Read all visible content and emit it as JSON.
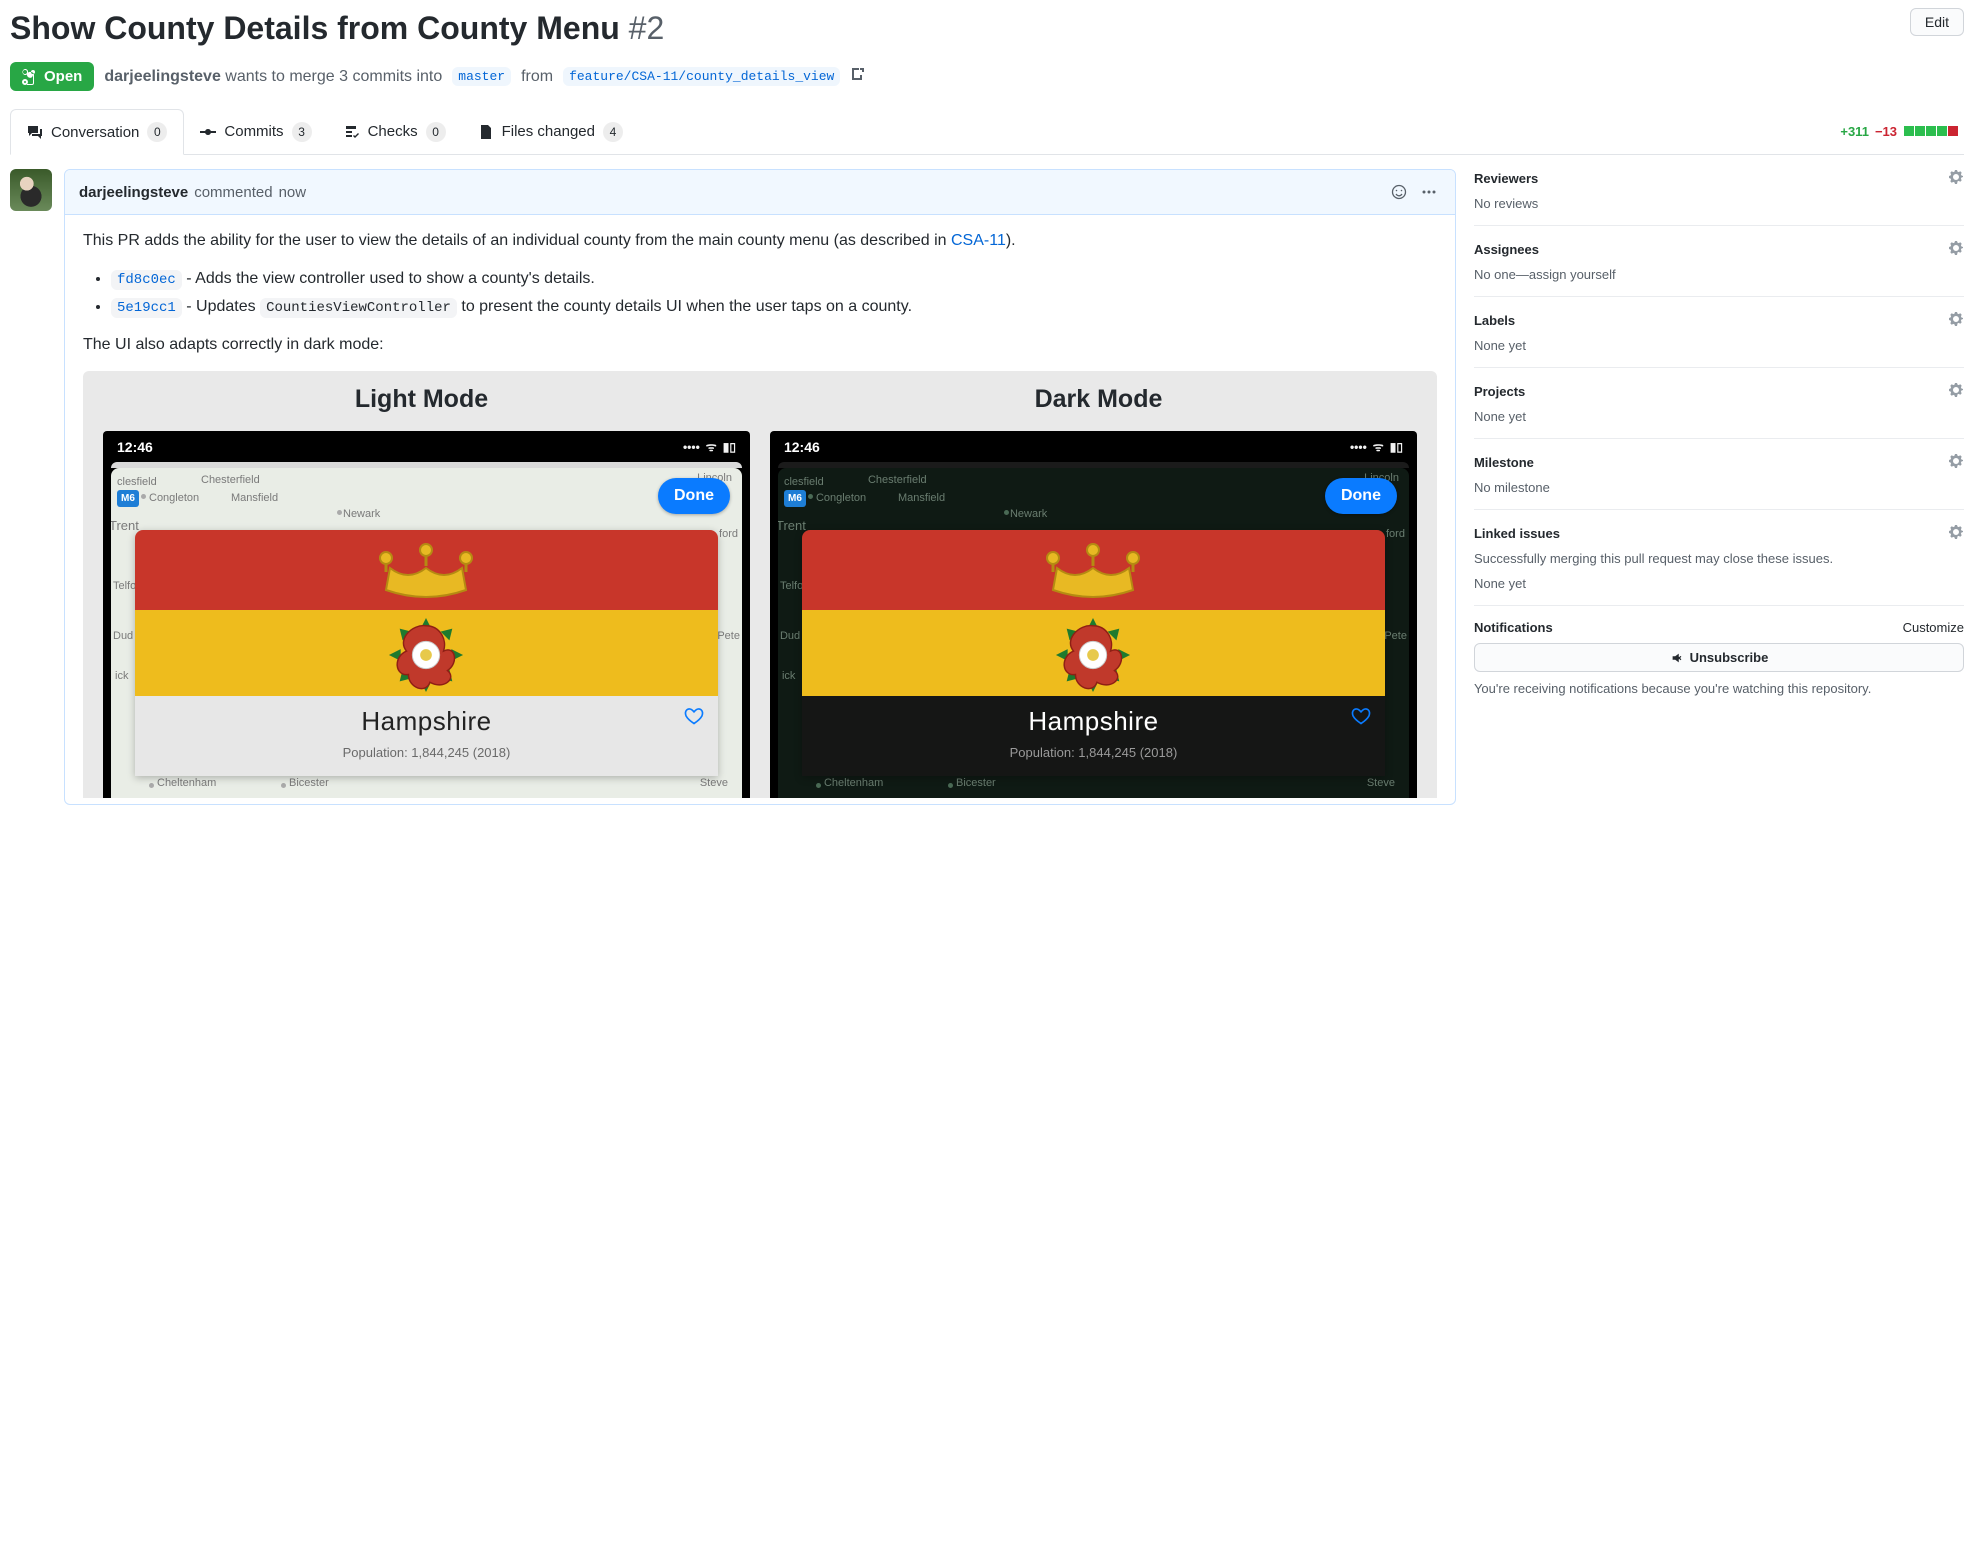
{
  "header": {
    "title": "Show County Details from County Menu",
    "number": "#2",
    "edit": "Edit"
  },
  "meta": {
    "state": "Open",
    "author": "darjeelingsteve",
    "wants_prefix": "wants to merge 3 commits into",
    "base_branch": "master",
    "from_word": "from",
    "compare_branch": "feature/CSA-11/county_details_view"
  },
  "tabs": {
    "conversation": {
      "label": "Conversation",
      "count": "0"
    },
    "commits": {
      "label": "Commits",
      "count": "3"
    },
    "checks": {
      "label": "Checks",
      "count": "0"
    },
    "files": {
      "label": "Files changed",
      "count": "4"
    },
    "additions": "+311",
    "deletions": "−13"
  },
  "comment": {
    "author": "darjeelingsteve",
    "verb": "commented",
    "time": "now",
    "body_intro_a": "This PR adds the ability for the user to view the details of an individual county from the main county menu (as described in ",
    "body_intro_link": "CSA-11",
    "body_intro_b": ").",
    "bullet1_commit": "fd8c0ec",
    "bullet1_text": " - Adds the view controller used to show a county's details.",
    "bullet2_commit": "5e19cc1",
    "bullet2_text_a": " - Updates ",
    "bullet2_code": "CountiesViewController",
    "bullet2_text_b": " to present the county details UI when the user taps on a county.",
    "darkmode_line": "The UI also adapts correctly in dark mode:"
  },
  "shots": {
    "light_title": "Light Mode",
    "dark_title": "Dark Mode",
    "clock": "12:46",
    "done": "Done",
    "county": "Hampshire",
    "population": "Population: 1,844,245 (2018)",
    "map": {
      "clesfield": "clesfield",
      "chesterfield": "Chesterfield",
      "lincoln": "Lincoln",
      "congleton": "Congleton",
      "mansfield": "Mansfield",
      "trent": "Trent",
      "newark": "Newark",
      "ford": "ford",
      "m6": "M6",
      "telford": "Telfo",
      "dud": "Dud",
      "pete": "Pete",
      "ick": "ick",
      "cheltenham": "Cheltenham",
      "bicester": "Bicester",
      "steve": "Steve"
    }
  },
  "sidebar": {
    "reviewers": {
      "title": "Reviewers",
      "body": "No reviews"
    },
    "assignees": {
      "title": "Assignees",
      "body_a": "No one—",
      "body_b": "assign yourself"
    },
    "labels": {
      "title": "Labels",
      "body": "None yet"
    },
    "projects": {
      "title": "Projects",
      "body": "None yet"
    },
    "milestone": {
      "title": "Milestone",
      "body": "No milestone"
    },
    "linked": {
      "title": "Linked issues",
      "desc": "Successfully merging this pull request may close these issues.",
      "body": "None yet"
    },
    "notifications": {
      "title": "Notifications",
      "customize": "Customize",
      "button": "Unsubscribe",
      "note": "You're receiving notifications because you're watching this repository."
    }
  }
}
